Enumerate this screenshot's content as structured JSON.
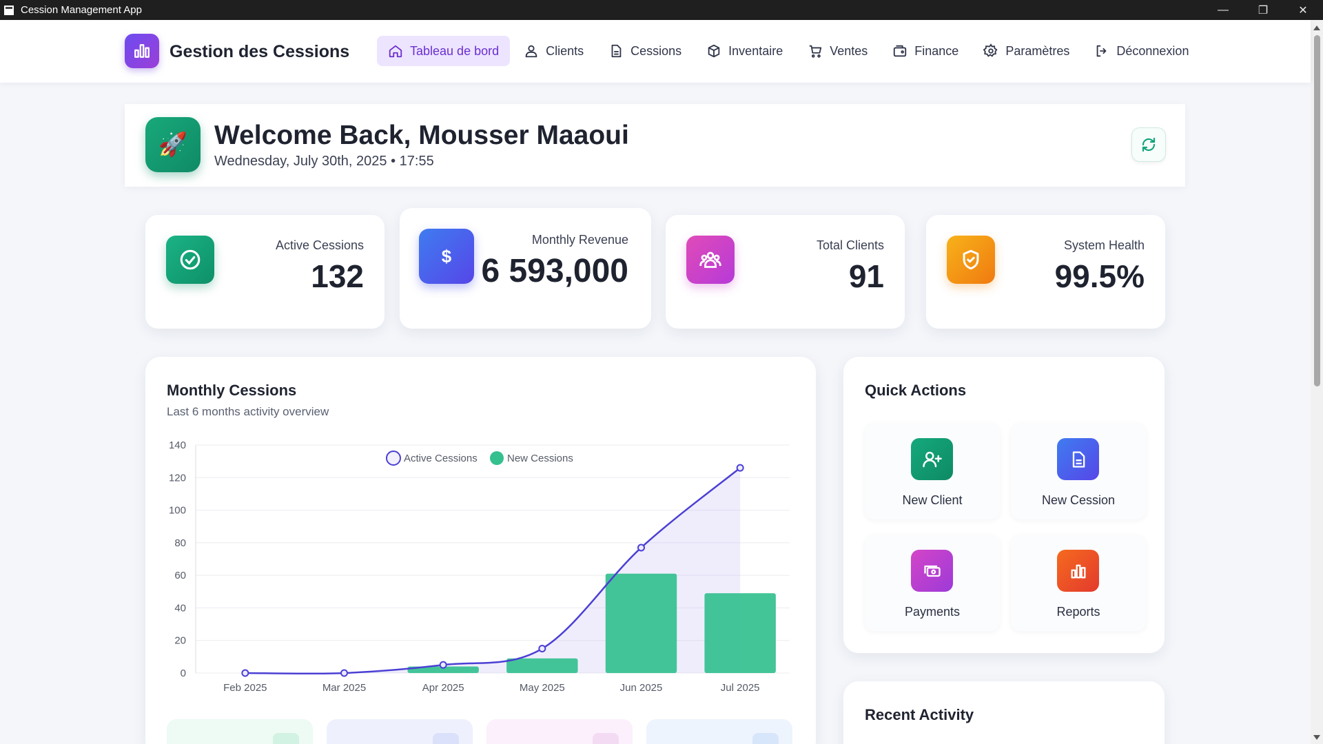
{
  "window": {
    "title": "Cession Management App"
  },
  "nav": {
    "brand": "Gestion des Cessions",
    "items": [
      {
        "label": "Tableau de bord",
        "icon": "home-icon",
        "active": true
      },
      {
        "label": "Clients",
        "icon": "users-icon"
      },
      {
        "label": "Cessions",
        "icon": "document-icon"
      },
      {
        "label": "Inventaire",
        "icon": "box-icon"
      },
      {
        "label": "Ventes",
        "icon": "cart-icon"
      },
      {
        "label": "Finance",
        "icon": "wallet-icon"
      },
      {
        "label": "Paramètres",
        "icon": "settings-icon"
      },
      {
        "label": "Déconnexion",
        "icon": "logout-icon"
      }
    ]
  },
  "welcome": {
    "greeting": "Welcome Back, Mousser Maaoui",
    "date": "Wednesday, July 30th, 2025 • 17:55"
  },
  "stats": [
    {
      "label": "Active Cessions",
      "value": "132",
      "color": "#13a37a"
    },
    {
      "label": "Monthly Revenue",
      "value": "6 593,000",
      "color": "#4b5cf0"
    },
    {
      "label": "Total Clients",
      "value": "91",
      "color": "#d044c8"
    },
    {
      "label": "System Health",
      "value": "99.5%",
      "color": "#f59a12"
    }
  ],
  "chart": {
    "title": "Monthly Cessions",
    "subtitle": "Last 6 months activity overview"
  },
  "chart_data": {
    "type": "bar",
    "categories": [
      "Feb 2025",
      "Mar 2025",
      "Apr 2025",
      "May 2025",
      "Jun 2025",
      "Jul 2025"
    ],
    "series": [
      {
        "name": "Active Cessions",
        "type": "line",
        "values": [
          0,
          0,
          5,
          15,
          77,
          126
        ],
        "color": "#4b3fd4"
      },
      {
        "name": "New Cessions",
        "type": "bar",
        "values": [
          0,
          0,
          4,
          9,
          61,
          49
        ],
        "color": "#34c08f"
      }
    ],
    "ylim": [
      0,
      140
    ],
    "yticks": [
      0,
      20,
      40,
      60,
      80,
      100,
      120,
      140
    ],
    "legend": "top-center",
    "grid": true
  },
  "quick_actions": {
    "title": "Quick Actions",
    "items": [
      {
        "label": "New Client",
        "icon": "user-plus-icon",
        "color": "#13a37a"
      },
      {
        "label": "New Cession",
        "icon": "file-icon",
        "color": "#4b5cf0"
      },
      {
        "label": "Payments",
        "icon": "money-icon",
        "color": "#c23fd0"
      },
      {
        "label": "Reports",
        "icon": "bar-chart-icon",
        "color": "#f04a2a"
      }
    ]
  },
  "recent": {
    "title": "Recent Activity"
  }
}
